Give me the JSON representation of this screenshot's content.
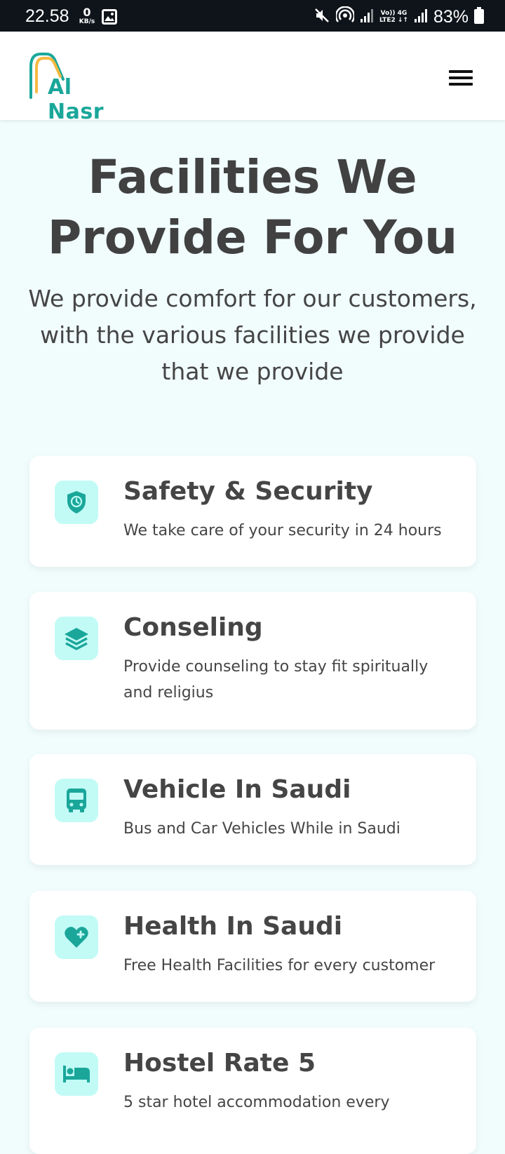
{
  "status_bar": {
    "time": "22.58",
    "net_speed_value": "0",
    "net_speed_unit": "KB/s",
    "lte_line1": "Vo)) 4G",
    "lte_line2": "LTE2 ↓↑",
    "battery_text": "83%",
    "icons": [
      "image-icon",
      "mute-icon",
      "hotspot-icon",
      "signal-icon",
      "battery-icon"
    ]
  },
  "header": {
    "logo_text": "Al Nasr",
    "menu_icon": "hamburger-menu-icon"
  },
  "hero": {
    "title_line1": "Facilities We",
    "title_line2": "Provide For You",
    "subtitle": "We provide comfort for our customers, with the various facilities we provide that we provide"
  },
  "facilities": [
    {
      "icon": "shield-clock-icon",
      "title": "Safety & Security",
      "description": "We take care of your security in 24 hours"
    },
    {
      "icon": "layers-icon",
      "title": "Conseling",
      "description": "Provide counseling to stay fit spiritually and religius"
    },
    {
      "icon": "bus-icon",
      "title": "Vehicle In Saudi",
      "description": "Bus and Car Vehicles While in Saudi"
    },
    {
      "icon": "heart-plus-icon",
      "title": "Health In Saudi",
      "description": "Free Health Facilities for every customer"
    },
    {
      "icon": "bed-icon",
      "title": "Hostel Rate 5",
      "description": "5 star hotel accommodation every"
    }
  ],
  "colors": {
    "brand_teal": "#1aa79a",
    "brand_orange": "#f5b942",
    "icon_bg": "#c2fbf6",
    "page_bg": "#f1fcfc",
    "status_bar_bg": "#0f141b"
  }
}
